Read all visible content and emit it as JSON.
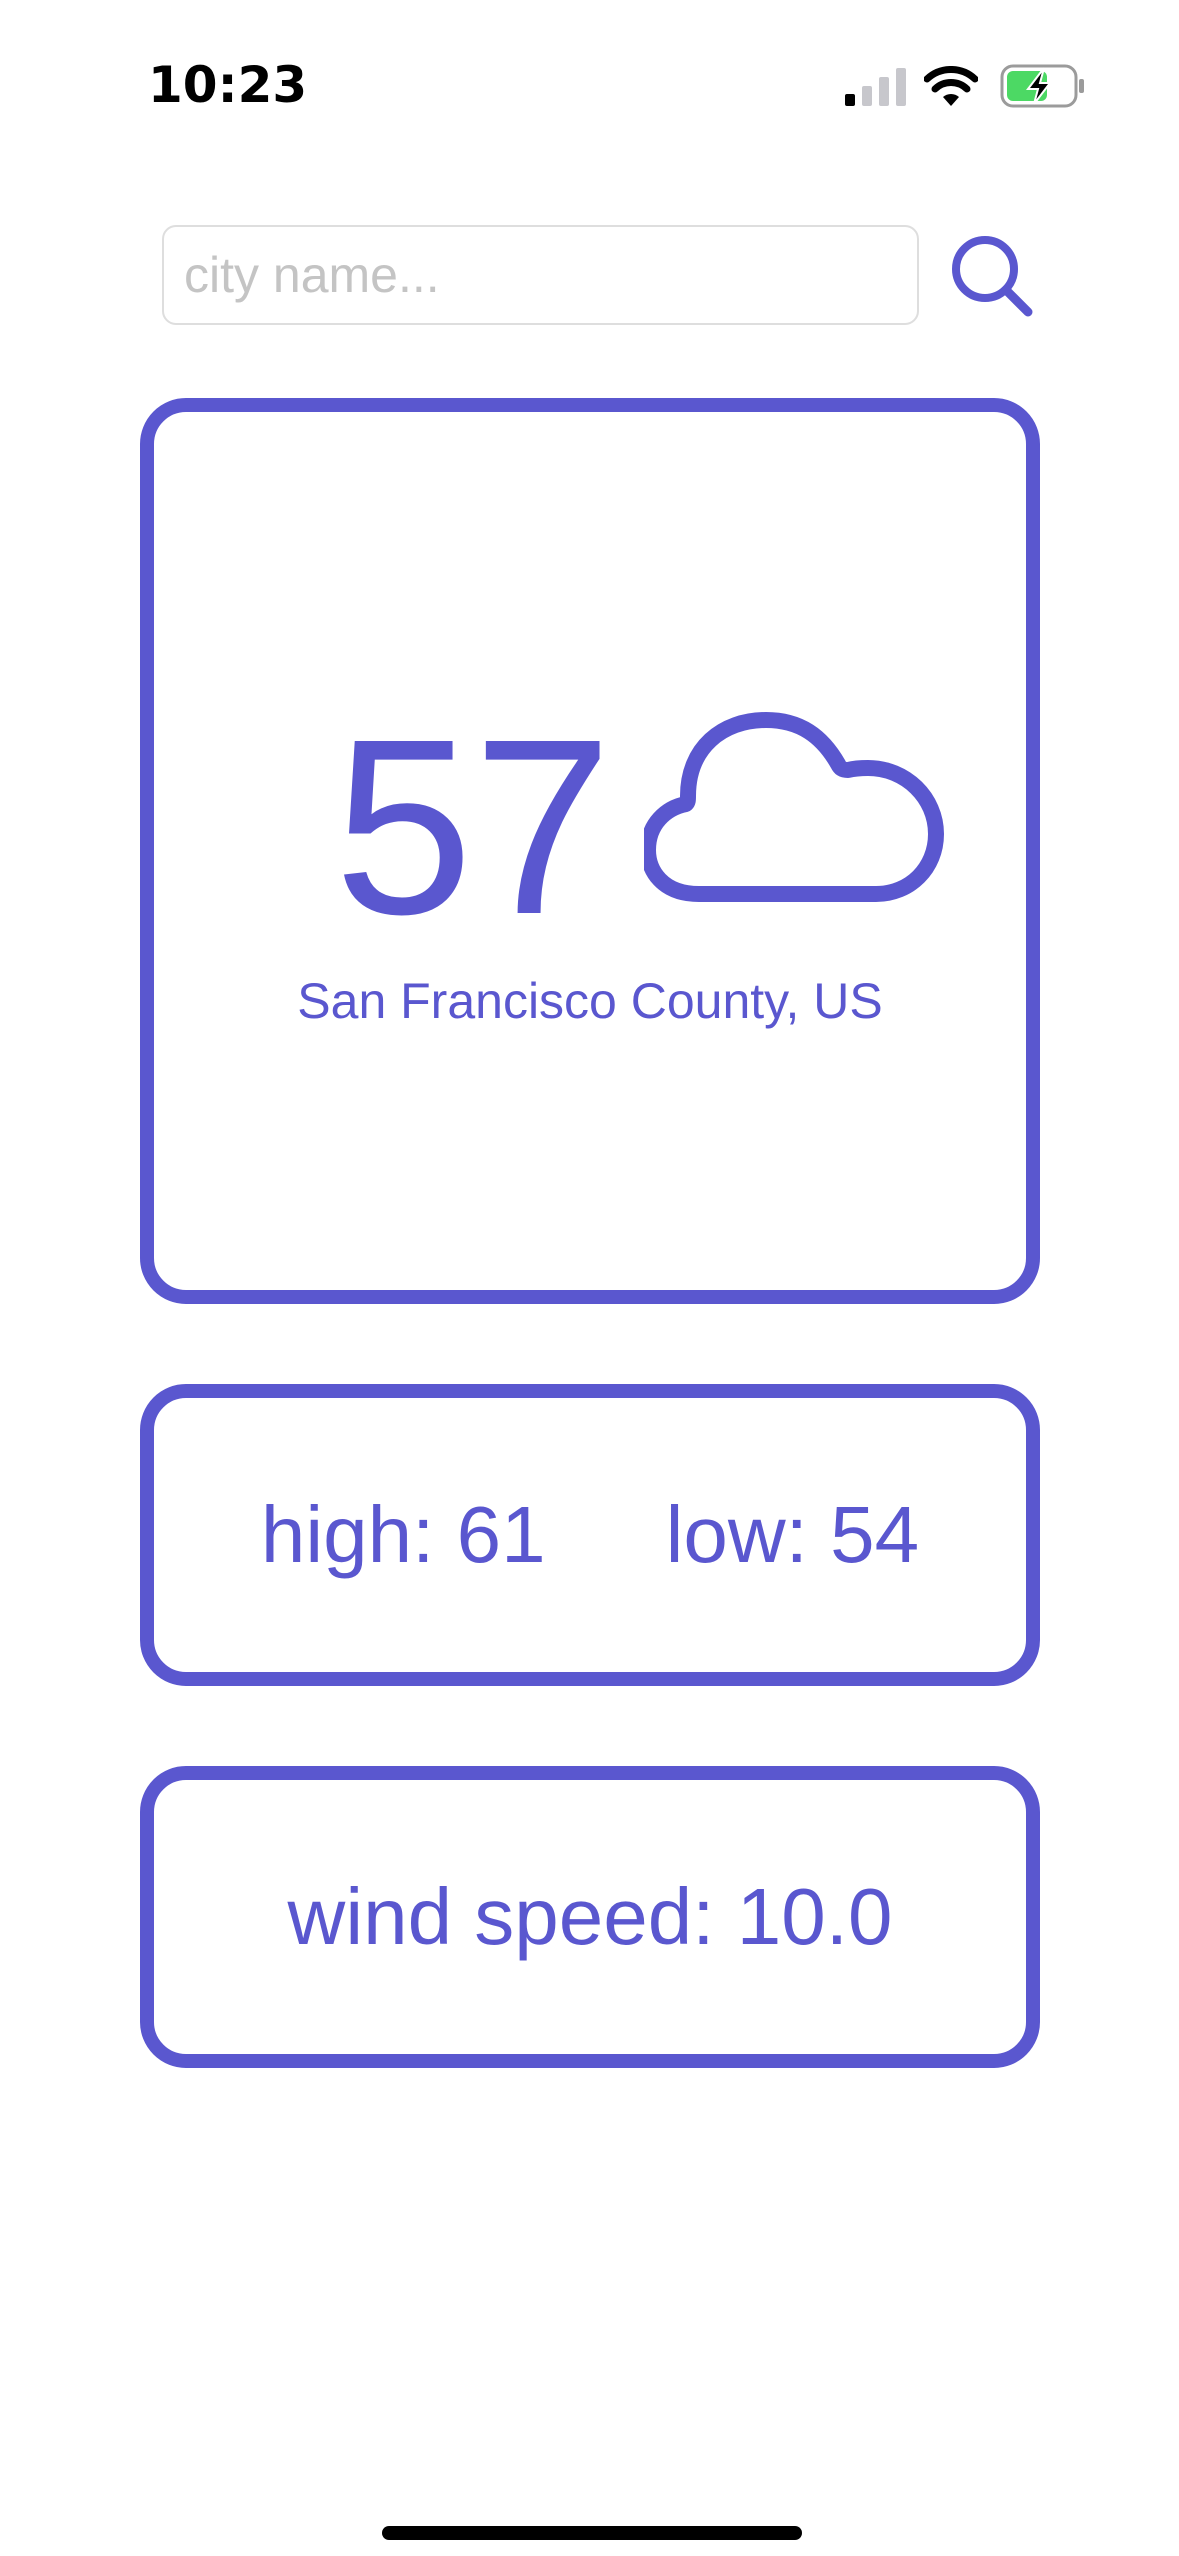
{
  "status_bar": {
    "time": "10:23"
  },
  "search": {
    "placeholder": "city name...",
    "value": ""
  },
  "weather": {
    "temperature": "57",
    "condition_icon": "cloud-icon",
    "location": "San Francisco County, US",
    "high_label": "high: 61",
    "low_label": "low: 54",
    "wind_label": "wind speed: 10.0"
  },
  "colors": {
    "accent": "#5a57cf",
    "battery_fill": "#4cd964"
  }
}
